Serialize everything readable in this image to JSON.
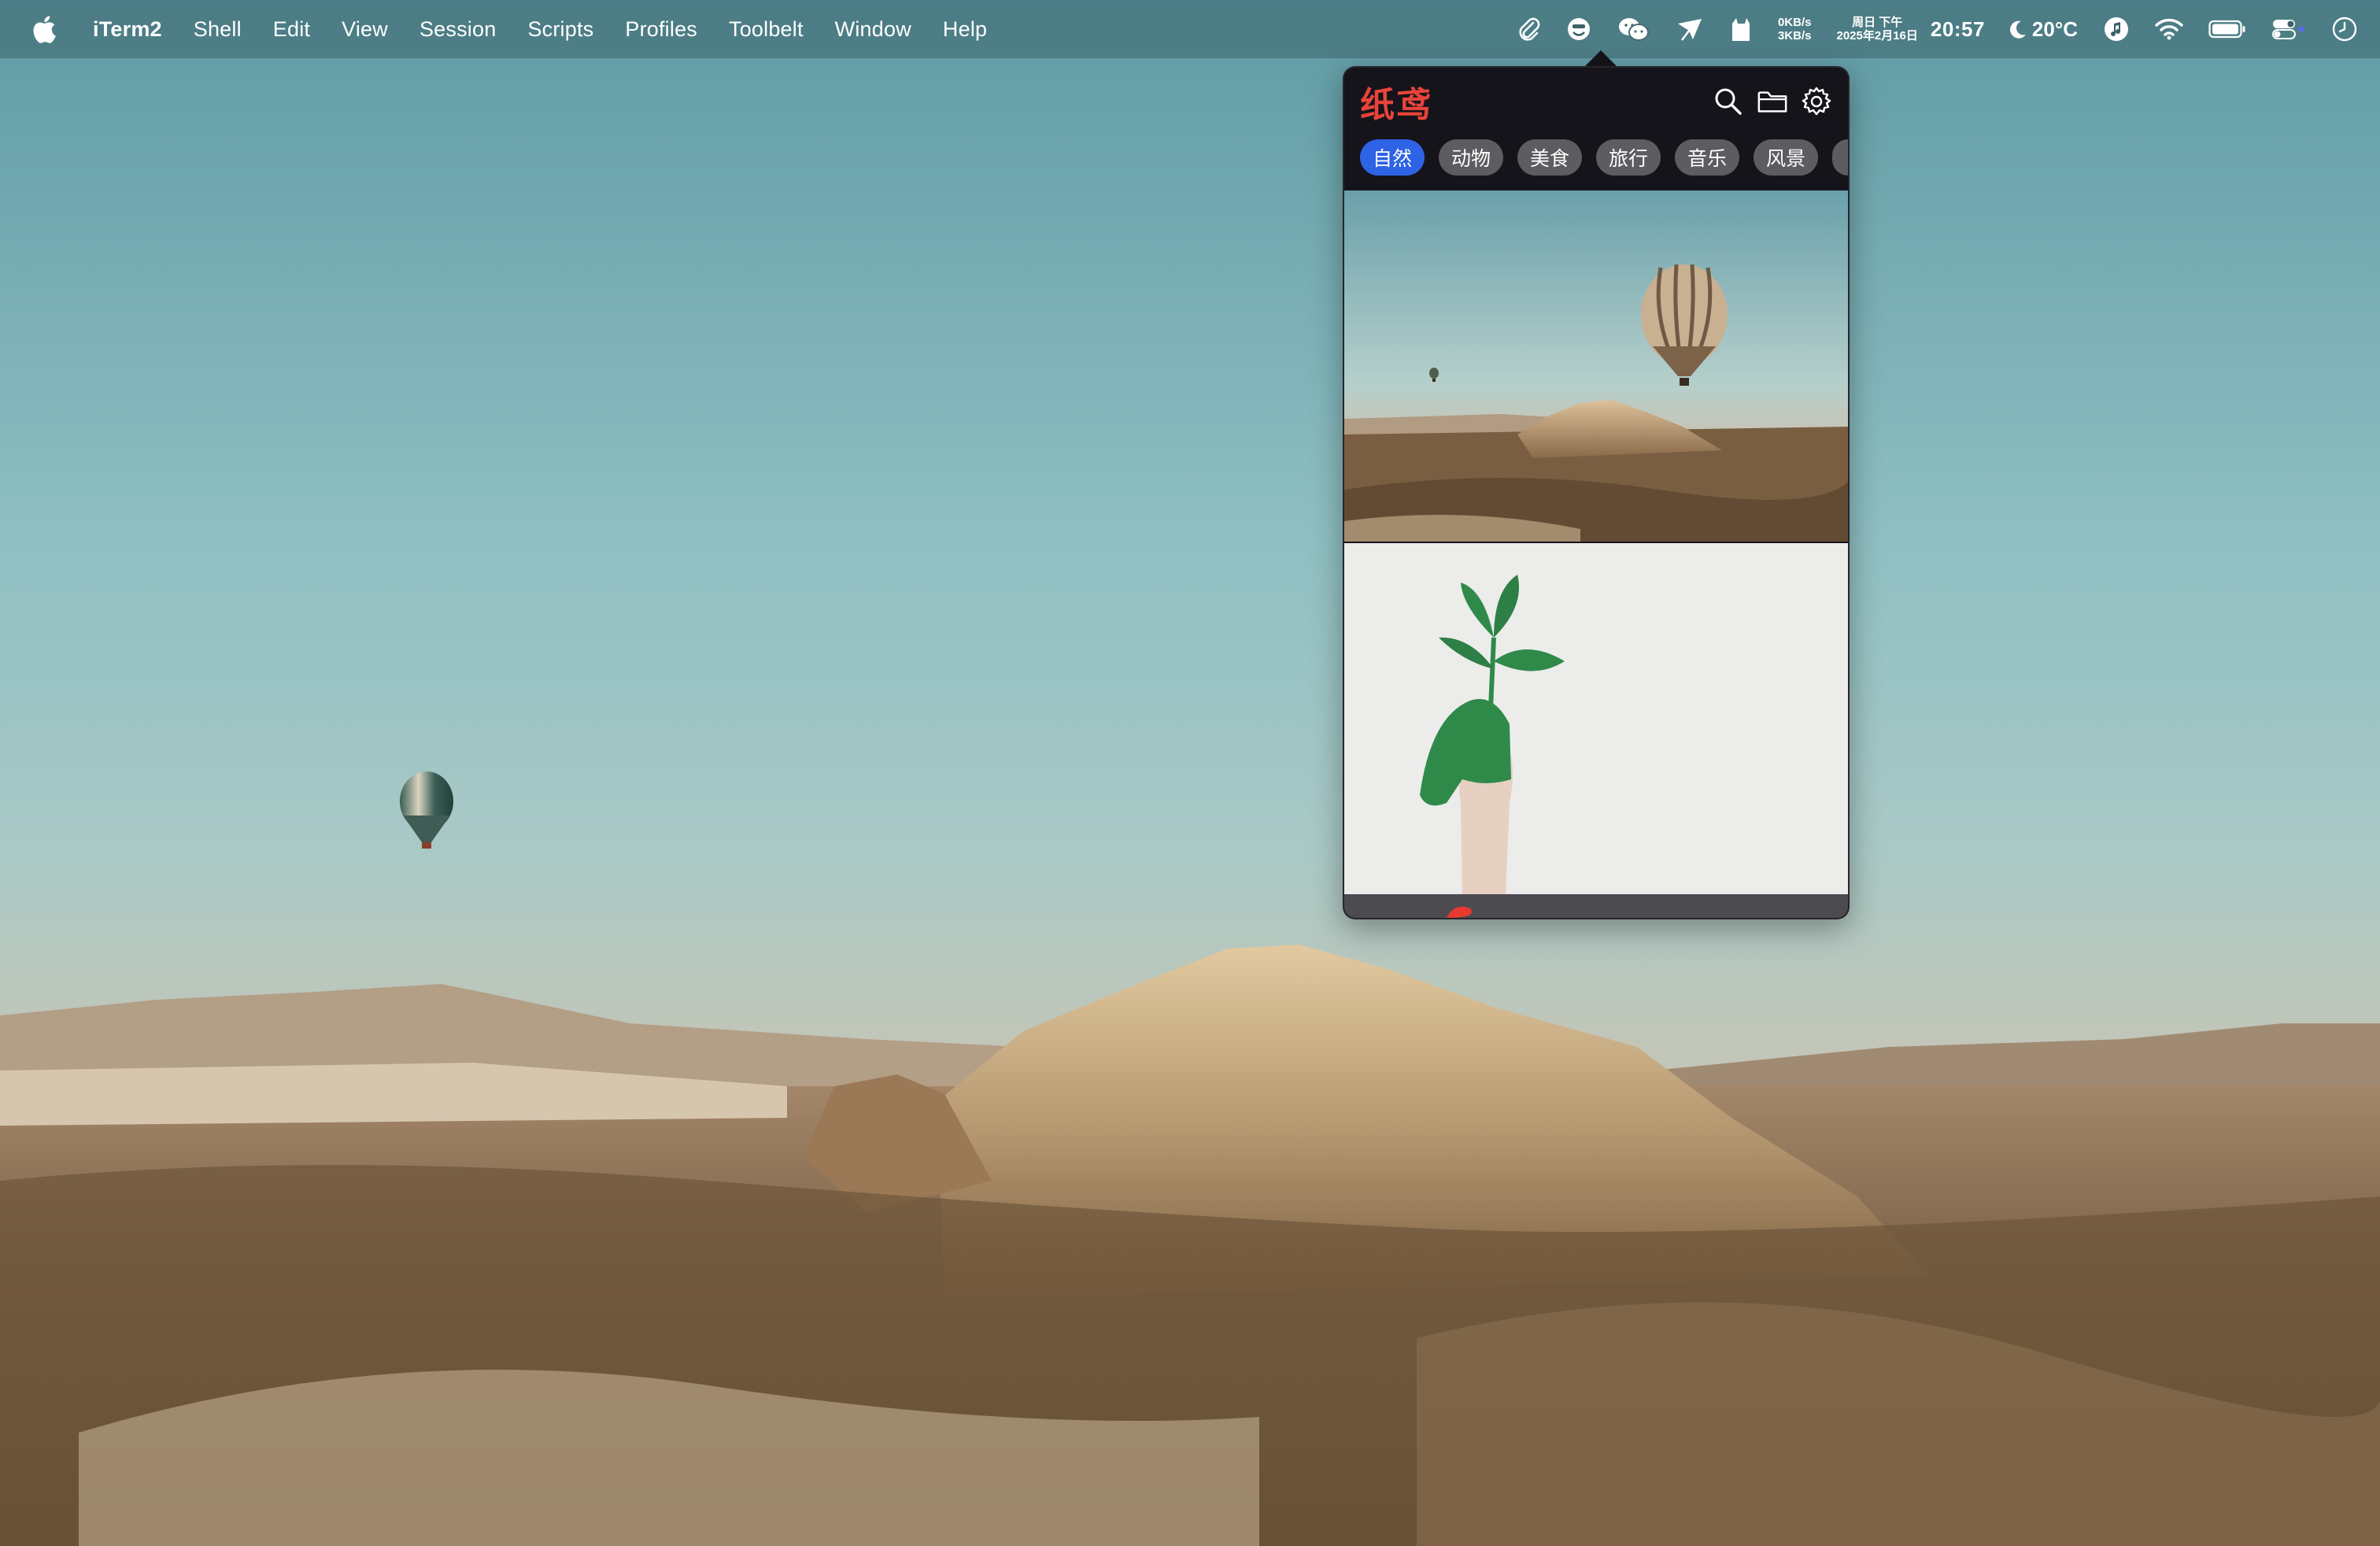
{
  "menubar": {
    "app_name": "iTerm2",
    "menus": [
      "Shell",
      "Edit",
      "View",
      "Session",
      "Scripts",
      "Profiles",
      "Toolbelt",
      "Window",
      "Help"
    ],
    "status": {
      "net_up": "0KB/s",
      "net_down": "3KB/s",
      "date_line1": "周日 下午",
      "date_line2": "2025年2月16日",
      "time": "20:57",
      "temperature": "20°C"
    },
    "icons": [
      "paperclip-icon",
      "face-icon",
      "wechat-icon",
      "kite-icon",
      "cat-icon",
      "weather-moon-icon",
      "music-icon",
      "wifi-icon",
      "battery-icon",
      "control-center-icon",
      "clock-icon"
    ]
  },
  "popover": {
    "brand": "纸鸢",
    "actions": [
      "search-icon",
      "folder-icon",
      "settings-icon"
    ],
    "tabs": [
      {
        "label": "自然",
        "active": true
      },
      {
        "label": "动物",
        "active": false
      },
      {
        "label": "美食",
        "active": false
      },
      {
        "label": "旅行",
        "active": false
      },
      {
        "label": "音乐",
        "active": false
      },
      {
        "label": "风景",
        "active": false
      },
      {
        "label": "",
        "active": false
      }
    ]
  },
  "colors": {
    "accent": "#2f63e6",
    "brand": "#e8443b",
    "popover_bg": "#15141a",
    "tab_bg": "#5d5c60"
  }
}
